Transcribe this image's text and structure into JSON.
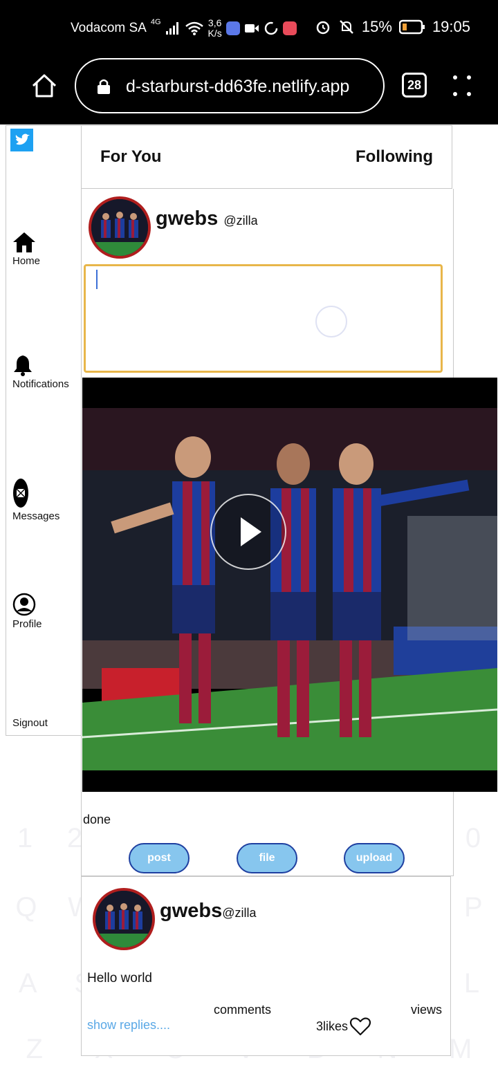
{
  "status_bar": {
    "carrier": "Vodacom SA",
    "network": "4G",
    "speed_value": "3,6",
    "speed_unit": "K/s",
    "battery": "15%",
    "time": "19:05"
  },
  "browser": {
    "url": "d-starburst-dd63fe.netlify.app",
    "tab_count": "28"
  },
  "sidebar": {
    "items": [
      {
        "label": "Home",
        "icon": "home-icon"
      },
      {
        "label": "Notifications",
        "icon": "bell-icon"
      },
      {
        "label": "Messages",
        "icon": "messages-icon"
      },
      {
        "label": "Profile",
        "icon": "profile-icon"
      },
      {
        "label": "Signout",
        "icon": ""
      }
    ]
  },
  "feed_tabs": {
    "for_you": "For You",
    "following": "Following"
  },
  "composer": {
    "username": "gwebs",
    "handle": "@zilla",
    "text_value": "",
    "done_label": "done",
    "buttons": {
      "post": "post",
      "file": "file",
      "upload": "upload"
    }
  },
  "post": {
    "username": "gwebs",
    "handle": "@zilla",
    "text": "Hello world",
    "comments_label": "comments",
    "views_label": "views",
    "show_replies": "show replies....",
    "likes": "3likes"
  },
  "colors": {
    "accent_blue": "#87c6ee",
    "button_border": "#1e3fa0",
    "textarea_border": "#e8b64a",
    "avatar_ring": "#b01e1e",
    "link": "#5aa8e6"
  }
}
